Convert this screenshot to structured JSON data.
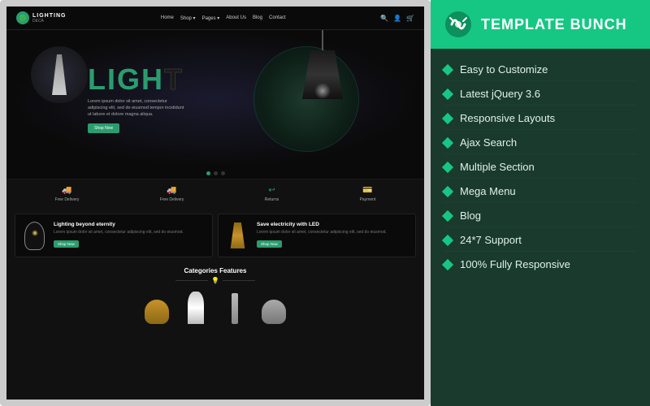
{
  "left": {
    "navbar": {
      "logo": "LIGHTING",
      "logo_sub": "DECA",
      "nav_items": [
        "Home",
        "Shop ▾",
        "Pages ▾",
        "About Us",
        "Blog",
        "Contact"
      ],
      "icons": [
        "🔍",
        "👤",
        "🛒"
      ]
    },
    "hero": {
      "title": "LIGHT",
      "body_text": "Lorem ipsum dolor sit amet, consectetur adipiscing elit, sed do eiusmod tempor incididunt ut labore et dolore magna aliqua.",
      "shop_btn": "Shop Now"
    },
    "features": [
      {
        "icon": "🚚",
        "label": "Free Delivery"
      },
      {
        "icon": "🚚",
        "label": "Free Delivery"
      },
      {
        "icon": "↩",
        "label": "Returns"
      },
      {
        "icon": "💳",
        "label": "Payment"
      }
    ],
    "product_cards": [
      {
        "title": "Lighting beyond eternity",
        "desc": "Lorem ipsum dolor sit amet, consectetur adipiscing elit, sed do eiusmod.",
        "btn": "Shop Now"
      },
      {
        "title": "Save electricity with LED",
        "desc": "Lorem ipsum dolor sit amet, consectetur adipiscing elit, sed do eiusmod.",
        "btn": "Shop Now"
      }
    ],
    "categories": {
      "title": "Categories Features"
    }
  },
  "right": {
    "brand": "TEMPLATE BUNCH",
    "features": [
      "Easy to Customize",
      "Latest jQuery 3.6",
      "Responsive Layouts",
      "Ajax Search",
      "Multiple Section",
      "Mega Menu",
      "Blog",
      "24*7 Support",
      "100% Fully Responsive"
    ]
  }
}
